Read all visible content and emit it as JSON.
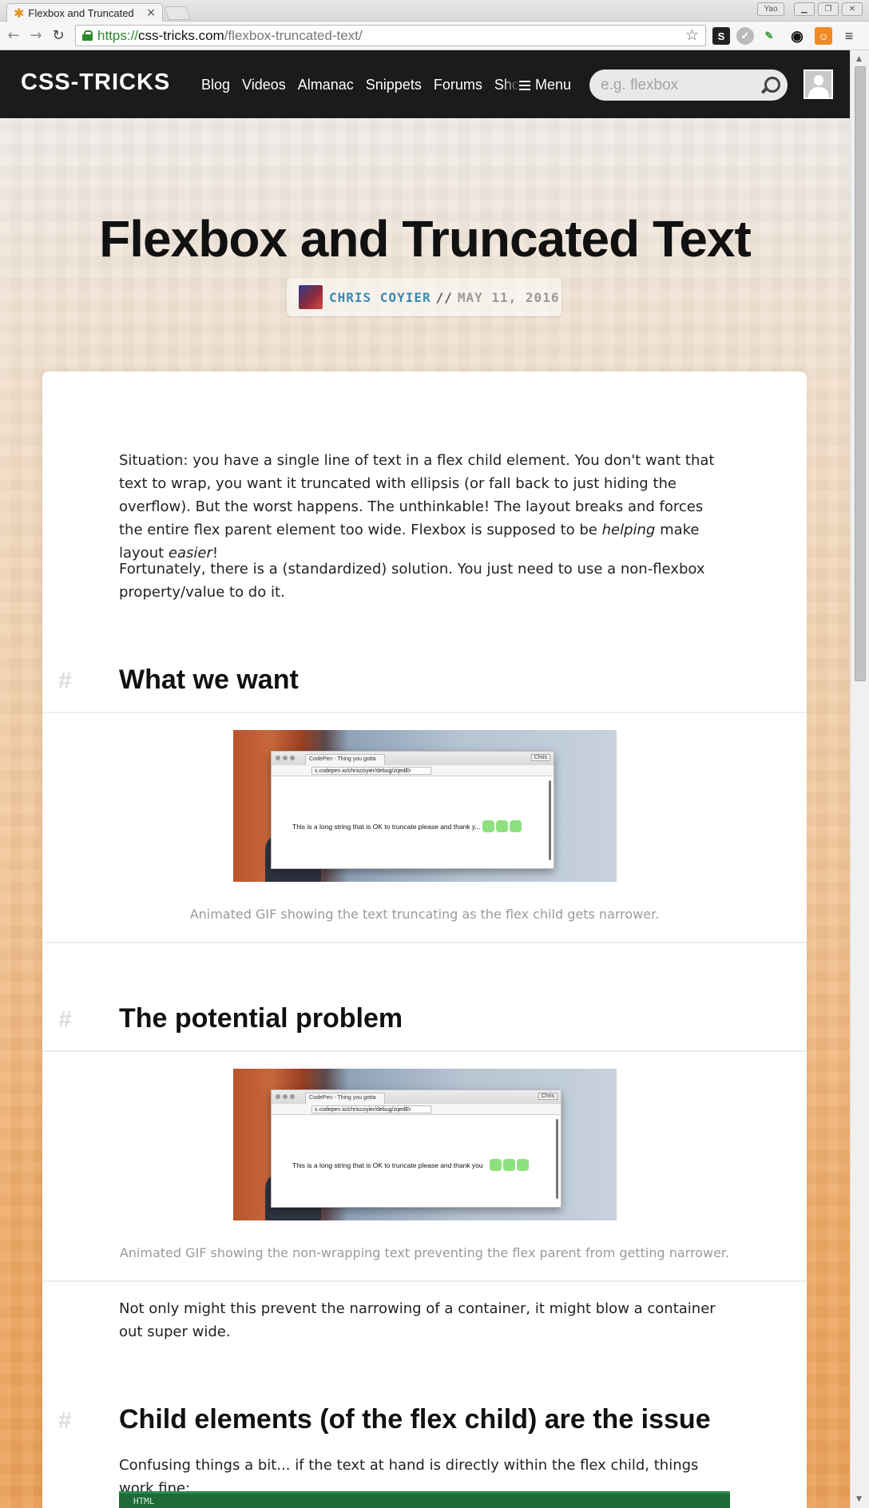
{
  "browser": {
    "tab_title": "Flexbox and Truncated",
    "tab_close": "×",
    "user_badge": "Yao",
    "url_scheme": "https://",
    "url_host": "css-tricks.com",
    "url_path": "/flexbox-truncated-text/",
    "extensions": [
      "s-ext-icon",
      "circle-ext-icon",
      "eyedropper-icon",
      "ring-icon",
      "fox-ext-icon"
    ]
  },
  "site": {
    "logo": "CSS-TRICKS",
    "nav": [
      "Blog",
      "Videos",
      "Almanac",
      "Snippets",
      "Forums",
      "Shop"
    ],
    "menu_label": "Menu",
    "search_placeholder": "e.g. flexbox"
  },
  "article": {
    "title": "Flexbox and Truncated Text",
    "author": "CHRIS COYIER",
    "separator": "//",
    "date": "MAY 11, 2016",
    "intro_1_a": "Situation: you have a single line of text in a flex child element. You don't want that text to wrap, you want it truncated with ellipsis (or fall back to just hiding the overflow). But the worst happens. The unthinkable! The layout breaks and forces the entire flex parent element too wide. Flexbox is supposed to be ",
    "intro_1_em1": "helping",
    "intro_1_b": " make layout ",
    "intro_1_em2": "easier",
    "intro_1_c": "!",
    "intro_2": "Fortunately, there is a (standardized) solution. You just need to use a non-flexbox property/value to do it.",
    "hash": "#",
    "sections": [
      {
        "heading": "What we want",
        "caption": "Animated GIF showing the text truncating as the flex child gets narrower.",
        "gif": {
          "tab": "CodePen - Thing you gotta",
          "user": "Chris",
          "url": "s.codepen.io/chriscoyier/debug/zqedEr",
          "text": "This is a long string that is OK to truncate please and thank y..."
        }
      },
      {
        "heading": "The potential problem",
        "caption": "Animated GIF showing the non-wrapping text preventing the flex parent from getting narrower.",
        "gif": {
          "tab": "CodePen - Thing you gotta",
          "user": "Chris",
          "url": "s.codepen.io/chriscoyier/debug/zqedEr",
          "text": "This is a long string that is OK to truncate please and thank you"
        }
      }
    ],
    "after_problem": "Not only might this prevent the narrowing of a container, it might blow a container out super wide.",
    "section_3_heading": "Child elements (of the flex child) are the issue",
    "section_3_text": "Confusing things a bit... if the text at hand is directly within the flex child, things work fine:",
    "code_label": "HTML"
  }
}
